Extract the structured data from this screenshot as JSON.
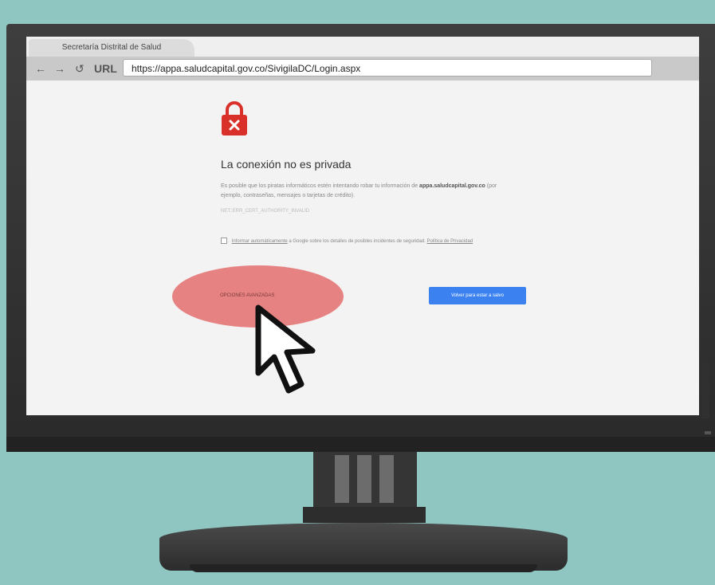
{
  "browser": {
    "tab_title": "Secretaría Distrital de Salud",
    "url_label": "URL",
    "url": "https://appa.saludcapital.gov.co/SivigilaDC/Login.aspx"
  },
  "error_page": {
    "title": "La conexión no es privada",
    "body_line1": "Es posible que los piratas informáticos estén intentando robar tu información de",
    "body_domain": "appa.saludcapital.gov.co",
    "body_line2": "(por ejemplo, contraseñas, mensajes o tarjetas de crédito).",
    "error_code": "NET::ERR_CERT_AUTHORITY_INVALID",
    "checkbox_link": "Informar automáticamente",
    "checkbox_text": "a Google sobre los detalles de posibles incidentes de seguridad.",
    "privacy_link": "Política de Privacidad",
    "advanced_button": "OPCIONES AVANZADAS",
    "safety_button": "Volver para estar a salvo"
  },
  "colors": {
    "lock": "#d9302a",
    "highlight": "#e57b7b",
    "primary_button": "#3b82f0"
  }
}
